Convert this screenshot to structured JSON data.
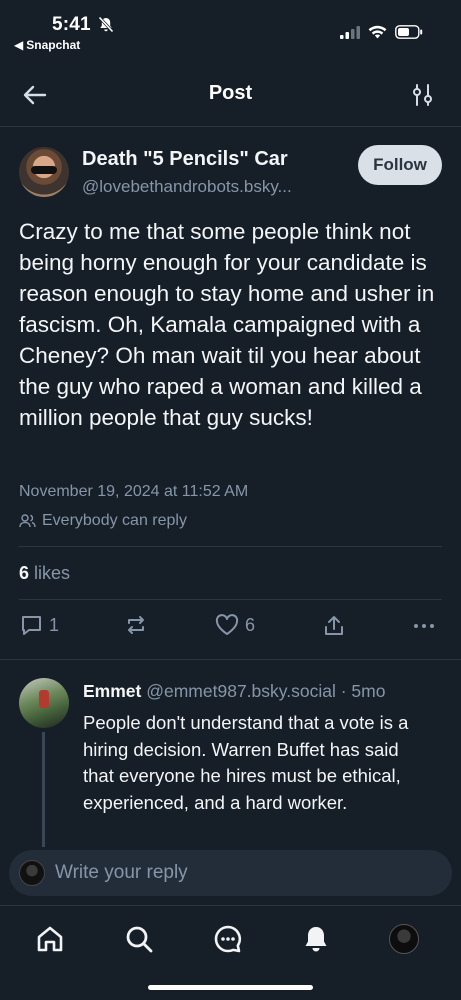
{
  "status": {
    "time": "5:41",
    "back_app": "Snapchat"
  },
  "header": {
    "title": "Post"
  },
  "post": {
    "author_name": "Death \"5 Pencils\" Car",
    "author_handle": "@lovebethandrobots.bsky...",
    "follow_label": "Follow",
    "text": "Crazy to me that some people think not being horny enough for your candidate is reason enough to stay home and usher in fascism. Oh, Kamala campaigned with a Cheney? Oh man wait til you hear about the guy who raped a woman and killed a million people that guy sucks!",
    "date": "November 19, 2024 at 11:52 AM",
    "reply_permission": "Everybody can reply",
    "likes_count": "6",
    "likes_label": "likes",
    "actions": {
      "reply_count": "1",
      "like_count": "6"
    }
  },
  "reply": {
    "name": "Emmet",
    "handle": "@emmet987.bsky.social",
    "age": "· 5mo",
    "text": "People don't understand that a vote is a hiring decision.  Warren Buffet has said that everyone he hires must be ethical, experienced, and a hard worker."
  },
  "composer": {
    "placeholder": "Write your reply"
  },
  "tabs": [
    "home-icon",
    "search-icon",
    "chat-icon",
    "bell-icon",
    "profile-avatar"
  ],
  "colors": {
    "background": "#161e27",
    "muted": "#8696a8",
    "follow_bg": "#d9e0e8"
  }
}
